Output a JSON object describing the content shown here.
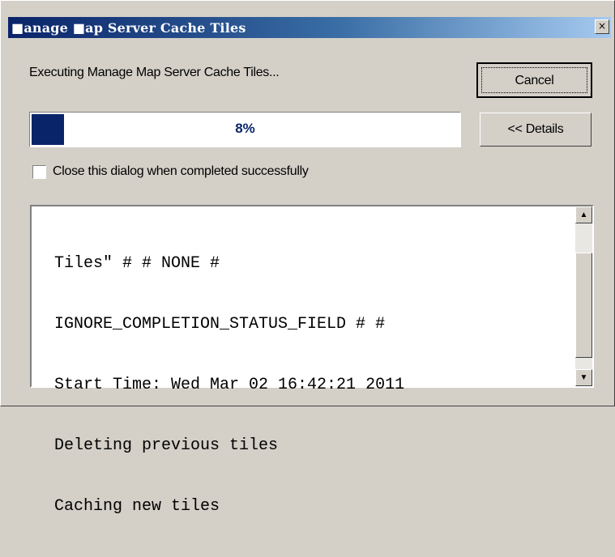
{
  "window": {
    "title": "■anage ■ap Server Cache Tiles",
    "close_glyph": "×"
  },
  "status": {
    "executing_text": "Executing Manage Map Server Cache Tiles..."
  },
  "buttons": {
    "cancel_label": "Cancel",
    "details_label": "<< Details"
  },
  "progress": {
    "percent": 8,
    "label": "8%",
    "fill_color": "#0a246a"
  },
  "options": {
    "close_when_done_label": "Close this dialog when completed successfully",
    "close_when_done_checked": false
  },
  "log": {
    "lines": [
      "Tiles\" # # NONE #",
      "IGNORE_COMPLETION_STATUS_FIELD # #",
      "Start Time: Wed Mar 02 16:42:21 2011",
      "Deleting previous tiles",
      "Caching new tiles"
    ]
  },
  "scrollbar": {
    "up_glyph": "▲",
    "down_glyph": "▼"
  }
}
